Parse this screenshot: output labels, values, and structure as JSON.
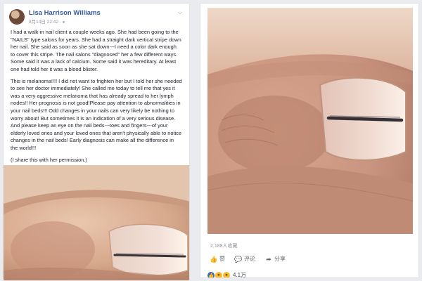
{
  "post": {
    "author": "Lisa Harrison Williams",
    "timestamp": "8月14日 22:42 · ",
    "paragraphs": [
      "I had a walk-in nail client a couple weeks ago. She had been going to the \"NAILS\" type salons for years. She had a straight dark vertical stripe down her nail. She said as soon as she sat down---I need a color dark enough to cover this stripe. The nail salons \"diagnosed\" her a few different ways. Some said it was a lack of calcium. Some said it was hereditary. At least one had told her it was a blood blister.",
      "This is melanoma!!!! I did not want to frighten her but I told her she needed to see her doctor immediately! She called me today to tell me that yes it was a very aggressive melanoma that has already spread to her lymph nodes!! Her prognosis is not good!Please pay attention to abnormalities in your nail beds!!! Odd changes in your nails can very likely be nothing to worry about! But sometimes it is an indication of a very serious disease. And please keep an eye on the nail beds---toes and fingers---of your elderly loved ones and your loved ones that aren't physically able to notice changes in the nail beds! Early diagnosis can make all the difference in the world!!!",
      "(I share this with her permission.)"
    ]
  },
  "stats": {
    "shares": "2,188人收藏"
  },
  "actions": {
    "like": "赞",
    "comment": "评论",
    "share": "分享"
  },
  "reactions": {
    "count": "4.1万"
  },
  "icons": {
    "avatar": "avatar",
    "menu": "chevron-down-icon",
    "like": "thumbs-up-icon",
    "comment": "speech-bubble-icon",
    "share": "share-arrow-icon"
  },
  "colors": {
    "link": "#365899",
    "like_reaction": "#4267b2",
    "wow_reaction": "#f7b928"
  }
}
